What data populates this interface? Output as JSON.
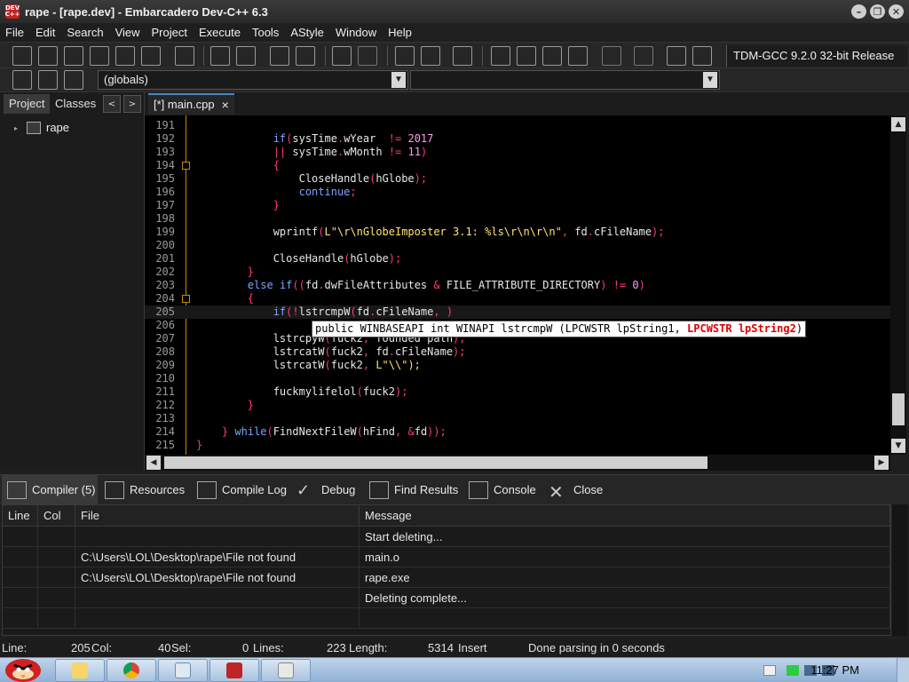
{
  "window": {
    "title": "rape - [rape.dev] - Embarcadero Dev-C++ 6.3",
    "app_icon_text": "DEV C++",
    "controls": [
      "minimize",
      "restore",
      "close"
    ]
  },
  "menu": [
    "File",
    "Edit",
    "Search",
    "View",
    "Project",
    "Execute",
    "Tools",
    "AStyle",
    "Window",
    "Help"
  ],
  "toolbar": {
    "compiler": "TDM-GCC 9.2.0 32-bit Release",
    "scope_combo": "(globals)",
    "function_combo": ""
  },
  "left_panel": {
    "tabs": [
      "Project",
      "Classes"
    ],
    "nav_prev": "<",
    "nav_next": ">",
    "tree": [
      {
        "label": "rape"
      }
    ]
  },
  "editor": {
    "tab_label": "[*] main.cpp",
    "tab_close": "×",
    "lines": [
      {
        "no": "191",
        "code": ""
      },
      {
        "no": "192",
        "code": "            if(sysTime.wYear  != 2017"
      },
      {
        "no": "193",
        "code": "            || sysTime.wMonth != 11)"
      },
      {
        "no": "194",
        "code": "            {"
      },
      {
        "no": "195",
        "code": "                CloseHandle(hGlobe);"
      },
      {
        "no": "196",
        "code": "                continue;"
      },
      {
        "no": "197",
        "code": "            }"
      },
      {
        "no": "198",
        "code": ""
      },
      {
        "no": "199",
        "code": "            wprintf(L\"\\r\\nGlobeImposter 3.1: %ls\\r\\n\\r\\n\", fd.cFileName);"
      },
      {
        "no": "200",
        "code": ""
      },
      {
        "no": "201",
        "code": "            CloseHandle(hGlobe);"
      },
      {
        "no": "202",
        "code": "        }"
      },
      {
        "no": "203",
        "code": "        else if((fd.dwFileAttributes & FILE_ATTRIBUTE_DIRECTORY) != 0)"
      },
      {
        "no": "204",
        "code": "        {"
      },
      {
        "no": "205",
        "code": "            if(!lstrcmpW(fd.cFileName, )"
      },
      {
        "no": "206",
        "code": ""
      },
      {
        "no": "207",
        "code": "            lstrcpyW(fuck2, founded path);"
      },
      {
        "no": "208",
        "code": "            lstrcatW(fuck2, fd.cFileName);"
      },
      {
        "no": "209",
        "code": "            lstrcatW(fuck2, L\"\\\\\");"
      },
      {
        "no": "210",
        "code": ""
      },
      {
        "no": "211",
        "code": "            fuckmylifelol(fuck2);"
      },
      {
        "no": "212",
        "code": "        }"
      },
      {
        "no": "213",
        "code": ""
      },
      {
        "no": "214",
        "code": "    } while(FindNextFileW(hFind, &fd));"
      },
      {
        "no": "215",
        "code": "}"
      }
    ],
    "tooltip_plain": "public WINBASEAPI int WINAPI lstrcmpW (LPCWSTR lpString1, ",
    "tooltip_highlight": "LPCWSTR lpString2",
    "tooltip_close": ")"
  },
  "bottom_tabs": [
    "Compiler (5)",
    "Resources",
    "Compile Log",
    "Debug",
    "Find Results",
    "Console",
    "Close"
  ],
  "messages": {
    "columns": [
      "Line",
      "Col",
      "File",
      "Message"
    ],
    "rows": [
      {
        "line": "",
        "col": "",
        "file": "",
        "message": "Start deleting..."
      },
      {
        "line": "",
        "col": "",
        "file": "C:\\Users\\LOL\\Desktop\\rape\\File not found",
        "message": "main.o"
      },
      {
        "line": "",
        "col": "",
        "file": "C:\\Users\\LOL\\Desktop\\rape\\File not found",
        "message": "rape.exe"
      },
      {
        "line": "",
        "col": "",
        "file": "",
        "message": "Deleting complete..."
      },
      {
        "line": "",
        "col": "",
        "file": "",
        "message": ""
      }
    ]
  },
  "status": {
    "line_label": "Line:",
    "line_value": "205",
    "col_label": "Col:",
    "col_value": "40",
    "sel_label": "Sel:",
    "sel_value": "0",
    "lines_label": "Lines:",
    "lines_value": "223",
    "length_label": "Length:",
    "length_value": "5314",
    "mode": "Insert",
    "parse": "Done parsing in 0 seconds"
  },
  "taskbar": {
    "clock": "11:27 PM",
    "apps": [
      "explorer",
      "chrome",
      "notepad",
      "devcpp",
      "app"
    ]
  },
  "colors": {
    "keyword": "#7aa6ff",
    "punct": "#ff3a78",
    "number": "#ff9cf0",
    "string": "#ffe470",
    "fold": "#c98a00"
  }
}
